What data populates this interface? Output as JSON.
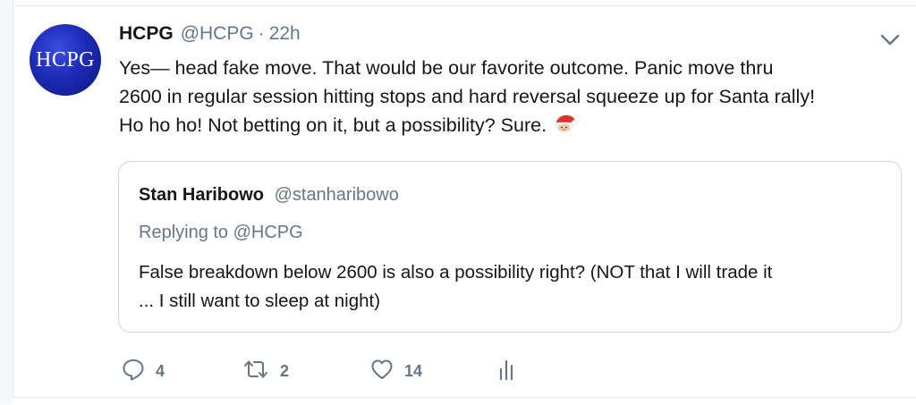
{
  "tweet": {
    "avatar_text": "HCPG",
    "display_name": "HCPG",
    "handle": "@HCPG",
    "separator": "·",
    "time": "22h",
    "text_lines": [
      "Yes— head fake move. That would be our favorite outcome.  Panic move thru",
      "2600 in regular session hitting stops and hard reversal squeeze up for Santa rally!",
      "Ho ho ho!   Not betting on it, but a possibility? Sure."
    ],
    "emoji_icon": "santa-claus-icon"
  },
  "quote": {
    "display_name": "Stan Haribowo",
    "handle": "@stanharibowo",
    "replying_to": "Replying to @HCPG",
    "text_lines": [
      "False breakdown below 2600 is also a possibility right? (NOT that I will trade it",
      "... I still want to sleep at night)"
    ]
  },
  "actions": {
    "reply_count": "4",
    "retweet_count": "2",
    "like_count": "14",
    "icons": [
      "reply-icon",
      "retweet-icon",
      "like-icon",
      "analytics-icon"
    ]
  },
  "colors": {
    "text": "#14171a",
    "secondary": "#657786",
    "border": "#ccd6dd",
    "avatar": "#1d2bb8"
  }
}
